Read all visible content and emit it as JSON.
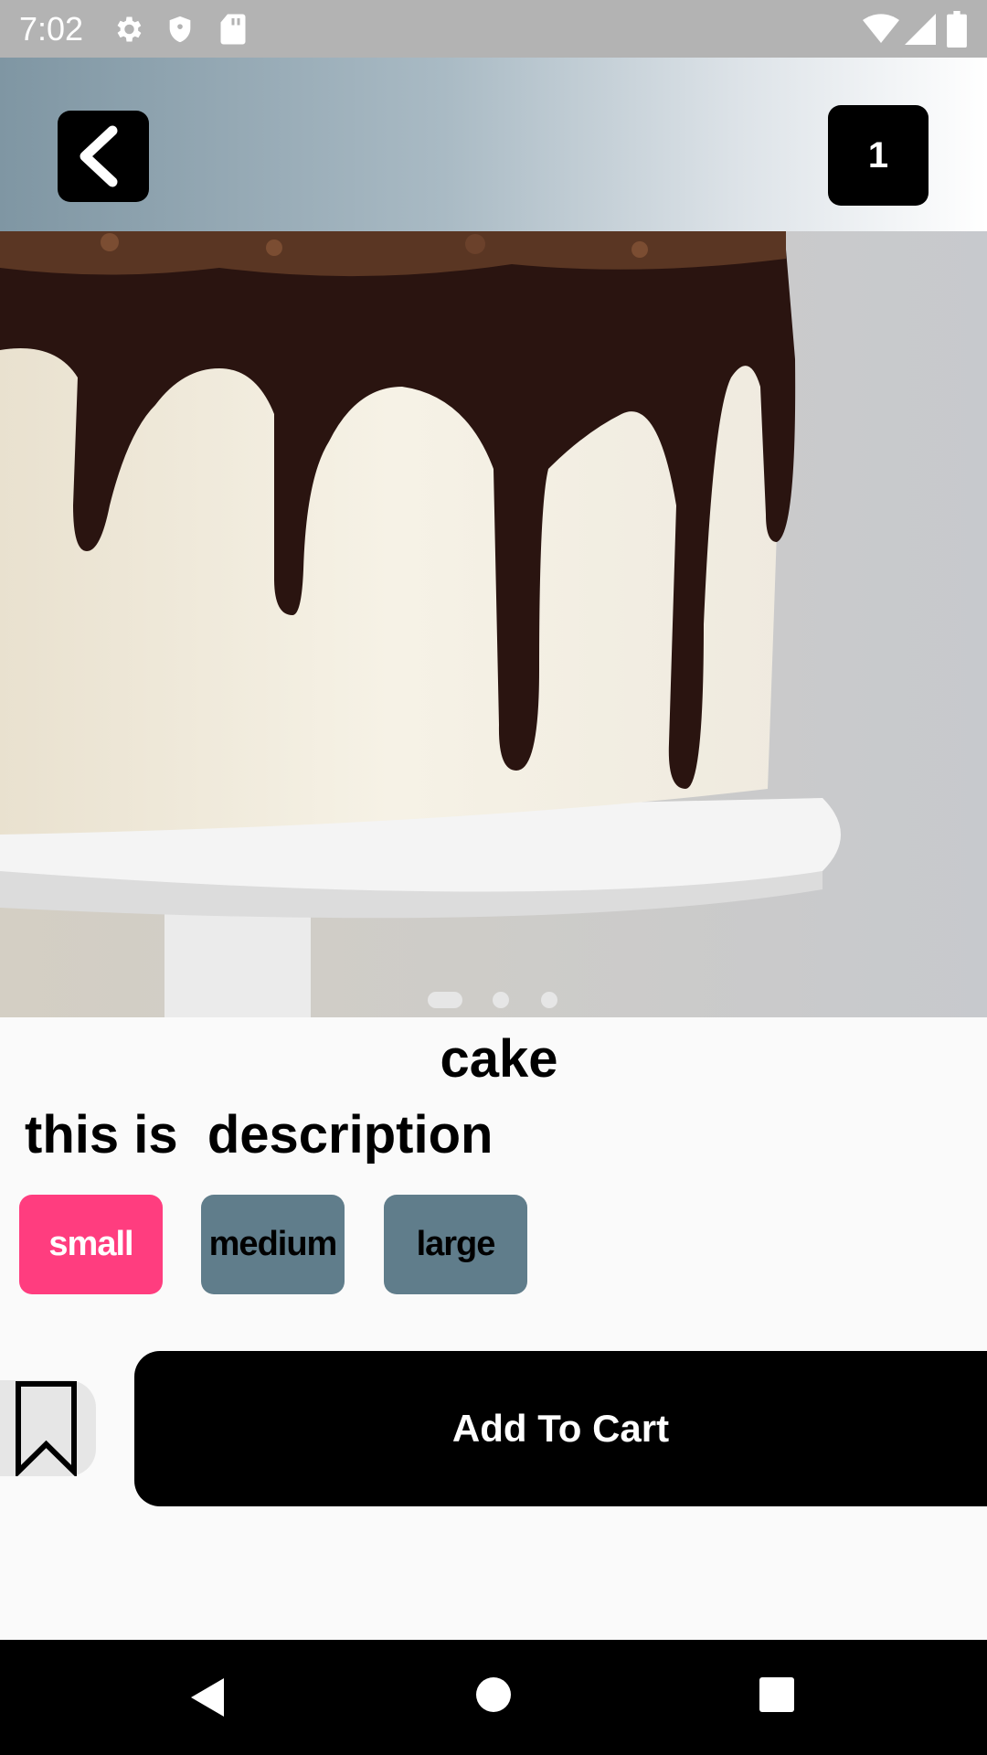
{
  "status_bar": {
    "time": "7:02",
    "icons": [
      "gear-icon",
      "shield-icon",
      "sd-card-icon",
      "wifi-icon",
      "signal-icon",
      "battery-icon"
    ]
  },
  "header": {
    "back_icon": "chevron-left-icon",
    "cart_count": "1"
  },
  "gallery": {
    "image": "chocolate-drip-cake-photo",
    "indicator_count": 3,
    "active_index": 0
  },
  "product": {
    "name": "cake",
    "description": "this is  description"
  },
  "sizes": [
    {
      "label": "small",
      "selected": true
    },
    {
      "label": "medium",
      "selected": false
    },
    {
      "label": "large",
      "selected": false
    }
  ],
  "actions": {
    "bookmark_icon": "bookmark-icon",
    "add_to_cart_label": "Add To Cart"
  },
  "colors": {
    "accent_selected": "#ff3d7f",
    "size_unselected": "#607d8b",
    "button_bg": "#000000"
  },
  "nav_bar": {
    "icons": [
      "nav-back-icon",
      "nav-home-icon",
      "nav-recents-icon"
    ]
  }
}
